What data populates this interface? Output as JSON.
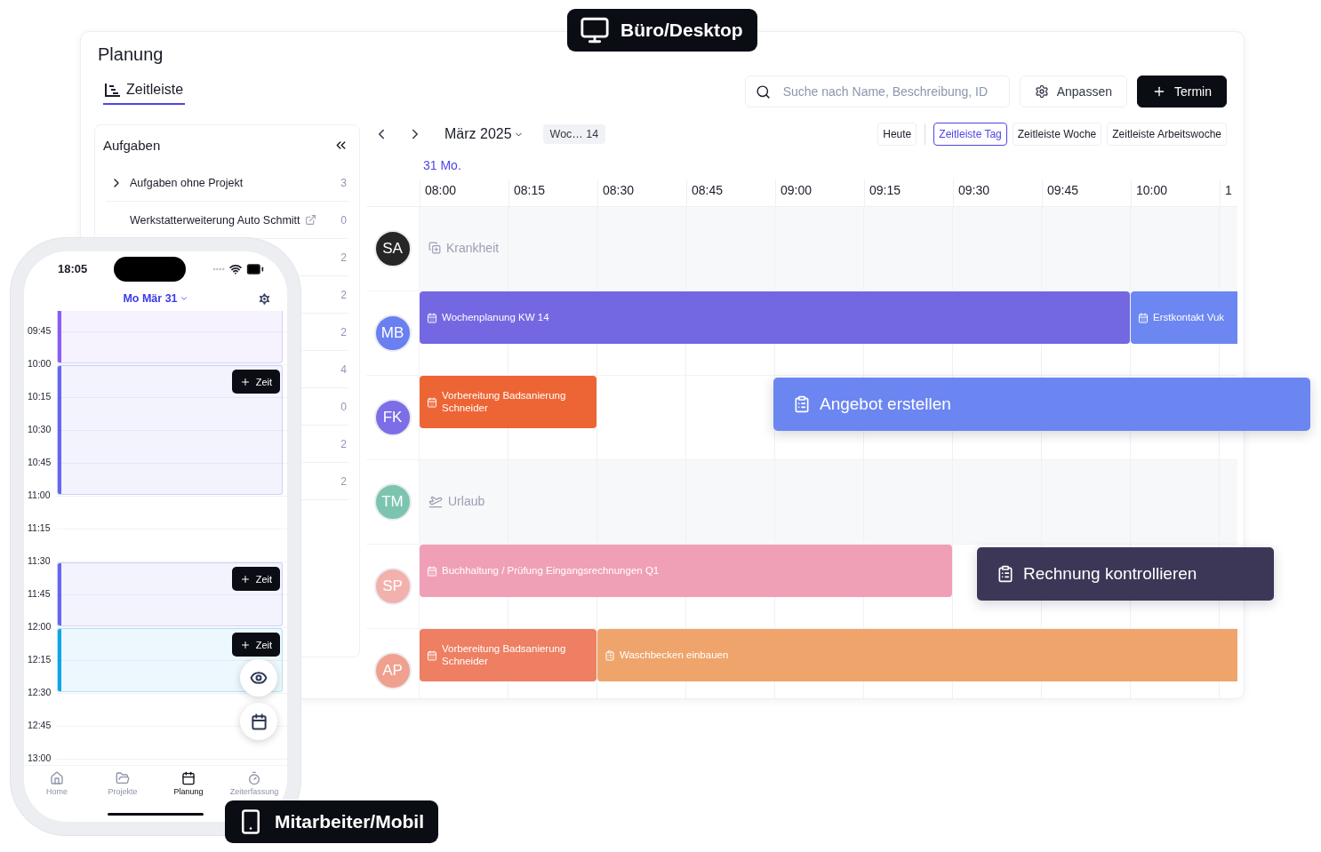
{
  "badges": [
    {
      "kind": "desktop",
      "label": "Büro/Desktop"
    },
    {
      "kind": "mobile",
      "label": "Mitarbeiter/Mobil"
    }
  ],
  "desktop": {
    "title": "Planung",
    "tabs": [
      {
        "label": "Zeitleiste",
        "selected": true
      }
    ],
    "search": {
      "placeholder": "Suche nach Name, Beschreibung, ID"
    },
    "buttons": [
      {
        "kind": "settings",
        "label": "Anpassen"
      },
      {
        "kind": "add",
        "label": "Termin"
      }
    ],
    "sidebar": {
      "title": "Aufgaben",
      "rows": [
        {
          "kind": "group",
          "label": "Aufgaben ohne Projekt",
          "count": "3"
        },
        {
          "kind": "project",
          "label": "Werkstatterweiterung Auto Schmitt",
          "count": "0"
        },
        {
          "kind": "item",
          "count": "2"
        },
        {
          "kind": "item",
          "count": "2"
        },
        {
          "kind": "item",
          "count": "2"
        },
        {
          "kind": "item",
          "count": "4"
        },
        {
          "kind": "item",
          "count": "0"
        },
        {
          "kind": "item",
          "count": "2"
        },
        {
          "kind": "item",
          "count": "2"
        }
      ]
    },
    "toolbar": {
      "month": "März 2025",
      "week": "Woc… 14",
      "views": [
        {
          "label": "Heute",
          "selected": false
        },
        {
          "label": "Zeitleiste Tag",
          "selected": true
        },
        {
          "label": "Zeitleiste Woche",
          "selected": false
        },
        {
          "label": "Zeitleiste Arbeitswoche",
          "selected": false
        }
      ]
    },
    "date": "31 Mo.",
    "times": [
      "08:00",
      "08:15",
      "08:30",
      "08:45",
      "09:00",
      "09:15",
      "09:30",
      "09:45",
      "10:00",
      "1"
    ],
    "resources": [
      {
        "initials": "SA",
        "color": "#262626",
        "absence": {
          "kind": "sick",
          "label": "Krankheit"
        }
      },
      {
        "initials": "MB",
        "color": "#6a7ff0",
        "events": [
          {
            "kind": "appointment",
            "label": "Wochenplanung KW  14",
            "color": "#7468e2"
          },
          {
            "kind": "appointment",
            "label": "Erstkontakt Vuk",
            "color": "#6c87f2"
          }
        ]
      },
      {
        "initials": "FK",
        "color": "#7b6ee6",
        "events": [
          {
            "kind": "appointment",
            "label": "Vorbereitung Badsanierung Schneider",
            "color": "#ee6535"
          }
        ]
      },
      {
        "initials": "TM",
        "color": "#7cc4b0",
        "absence": {
          "kind": "vacation",
          "label": "Urlaub"
        }
      },
      {
        "initials": "SP",
        "color": "#f3b1ae",
        "events": [
          {
            "kind": "appointment",
            "label": "Buchhaltung / Prüfung Eingangsrechnungen Q1",
            "color": "#f0a0b6"
          }
        ]
      },
      {
        "initials": "AP",
        "color": "#f0a08e",
        "events": [
          {
            "kind": "appointment",
            "label": "Vorbereitung Badsanierung Schneider",
            "color": "#ee7f62"
          },
          {
            "kind": "task",
            "label": "Waschbecken einbauen",
            "color": "#eea46a"
          }
        ]
      }
    ]
  },
  "highlight_cards": [
    {
      "kind": "task",
      "label": "Angebot erstellen",
      "color": "#6b86f0"
    },
    {
      "kind": "task",
      "label": "Rechnung kontrollieren",
      "color": "#3d3757"
    }
  ],
  "phone": {
    "time": "18:05",
    "date": "Mo Mär 31",
    "times": [
      "09:45",
      "10:00",
      "10:15",
      "10:30",
      "10:45",
      "11:00",
      "11:15",
      "11:30",
      "11:45",
      "12:00",
      "12:15",
      "12:30",
      "12:45",
      "13:00"
    ],
    "events": [
      {
        "color": "#8b5cf6"
      },
      {
        "color": "#6366f1",
        "button": "Zeit"
      },
      {
        "color": "#6366f1",
        "button": "Zeit"
      },
      {
        "color": "#0ea5e9",
        "button": "Zeit"
      }
    ],
    "tabs": [
      {
        "kind": "home",
        "label": "Home",
        "selected": false
      },
      {
        "kind": "projects",
        "label": "Projekte",
        "selected": false
      },
      {
        "kind": "planning",
        "label": "Planung",
        "selected": true
      },
      {
        "kind": "time",
        "label": "Zeiterfassung",
        "selected": false
      }
    ]
  }
}
